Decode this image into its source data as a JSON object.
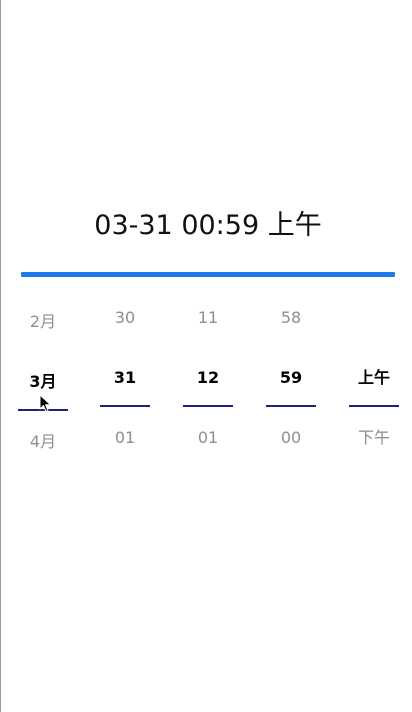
{
  "header": {
    "selected_datetime": "03-31 00:59 上午"
  },
  "colors": {
    "accent_bar": "#1c7bea",
    "selected_underline": "#1a237e",
    "unselected_text": "#8e8e93",
    "selected_text": "#000000"
  },
  "picker": {
    "month": {
      "prev": "2月",
      "selected": "3月",
      "next": "4月"
    },
    "day": {
      "prev": "30",
      "selected": "31",
      "next": "01"
    },
    "hour": {
      "prev": "11",
      "selected": "12",
      "next": "01"
    },
    "minute": {
      "prev": "58",
      "selected": "59",
      "next": "00"
    },
    "ampm": {
      "prev": "",
      "selected": "上午",
      "next": "下午"
    }
  },
  "icons": {
    "pointer": "mouse-pointer-icon"
  }
}
